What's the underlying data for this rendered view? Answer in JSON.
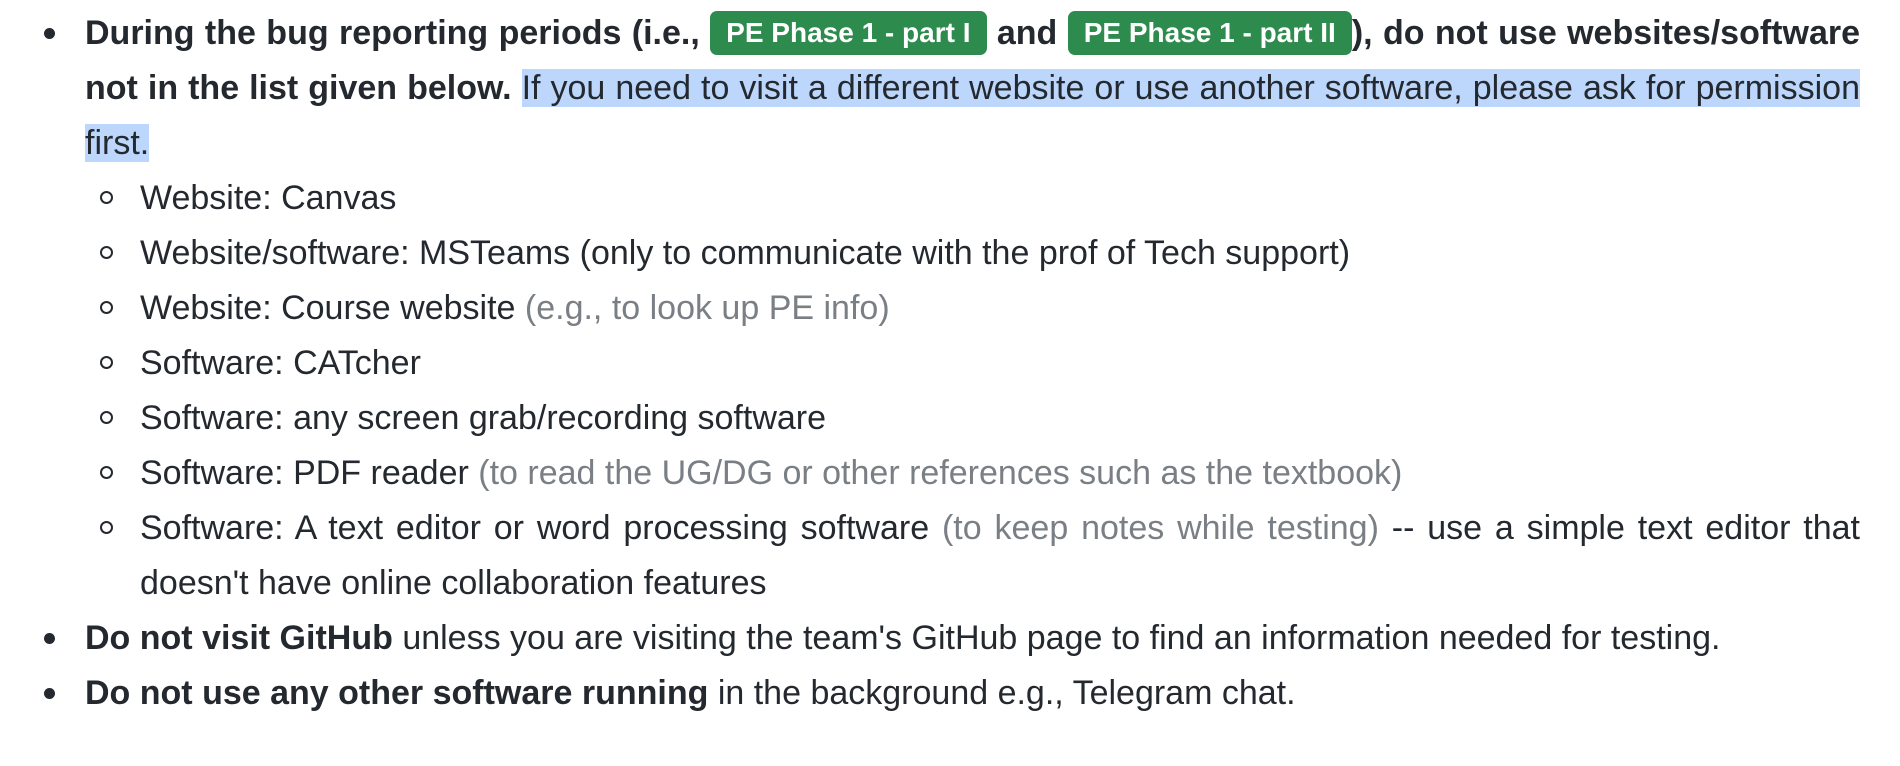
{
  "colors": {
    "text": "#24292f",
    "badge_bg": "#2e8b4e",
    "badge_text": "#ffffff",
    "highlight": "#bcd7fb",
    "muted": "#7a7f85"
  },
  "rules": {
    "rule1": {
      "bold_prefix": "During the bug reporting periods (i.e., ",
      "badge1": "PE Phase 1 - part I",
      "bold_middle": " and ",
      "badge2": "PE Phase 1 - part II",
      "bold_suffix": "), do not use websites/software not in the list given below.",
      "highlighted": "If you need to visit a different website or use another software, please ask for permission first.",
      "allowed": [
        {
          "main": "Website: Canvas",
          "note": ""
        },
        {
          "main": "Website/software: MSTeams (only to communicate with the prof of Tech support)",
          "note": ""
        },
        {
          "main": "Website: Course website",
          "note": "(e.g., to look up PE info)"
        },
        {
          "main": "Software: CATcher",
          "note": ""
        },
        {
          "main": "Software: any screen grab/recording software",
          "note": ""
        },
        {
          "main": "Software: PDF reader",
          "note": "(to read the UG/DG or other references such as the textbook)"
        },
        {
          "main": "Software: A text editor or word processing software",
          "note": "(to keep notes while testing)",
          "tail": "-- use a simple text editor that doesn't have online collaboration features"
        }
      ]
    },
    "rule2": {
      "bold": "Do not visit GitHub",
      "rest": "unless you are visiting the team's GitHub page to find an information needed for testing."
    },
    "rule3": {
      "bold": "Do not use any other software running",
      "rest": "in the background e.g., Telegram chat."
    }
  }
}
